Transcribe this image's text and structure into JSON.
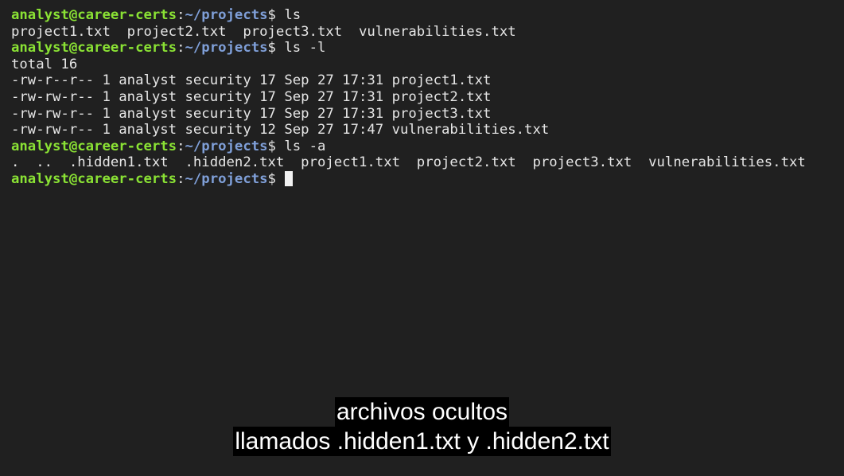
{
  "terminal": {
    "lines": [
      {
        "type": "prompt",
        "user": "analyst@career-certs",
        "sep": ":",
        "path": "~/projects",
        "dollar": "$ ",
        "command": "ls"
      },
      {
        "type": "output",
        "text": "project1.txt  project2.txt  project3.txt  vulnerabilities.txt"
      },
      {
        "type": "prompt",
        "user": "analyst@career-certs",
        "sep": ":",
        "path": "~/projects",
        "dollar": "$ ",
        "command": "ls -l"
      },
      {
        "type": "output",
        "text": "total 16"
      },
      {
        "type": "output",
        "text": "-rw-r--r-- 1 analyst security 17 Sep 27 17:31 project1.txt"
      },
      {
        "type": "output",
        "text": "-rw-rw-r-- 1 analyst security 17 Sep 27 17:31 project2.txt"
      },
      {
        "type": "output",
        "text": "-rw-rw-r-- 1 analyst security 17 Sep 27 17:31 project3.txt"
      },
      {
        "type": "output",
        "text": "-rw-rw-r-- 1 analyst security 12 Sep 27 17:47 vulnerabilities.txt"
      },
      {
        "type": "prompt",
        "user": "analyst@career-certs",
        "sep": ":",
        "path": "~/projects",
        "dollar": "$ ",
        "command": "ls -a"
      },
      {
        "type": "output",
        "text": ".  ..  .hidden1.txt  .hidden2.txt  project1.txt  project2.txt  project3.txt  vulnerabilities.txt"
      },
      {
        "type": "prompt",
        "user": "analyst@career-certs",
        "sep": ":",
        "path": "~/projects",
        "dollar": "$ ",
        "command": "",
        "cursor": true
      }
    ]
  },
  "subtitles": {
    "line1": "archivos ocultos",
    "line2": "llamados .hidden1.txt y .hidden2.txt"
  },
  "colors": {
    "background": "#202020",
    "prompt_user": "#8ae234",
    "prompt_path": "#7f9fd8",
    "text": "#e6e6e6"
  }
}
